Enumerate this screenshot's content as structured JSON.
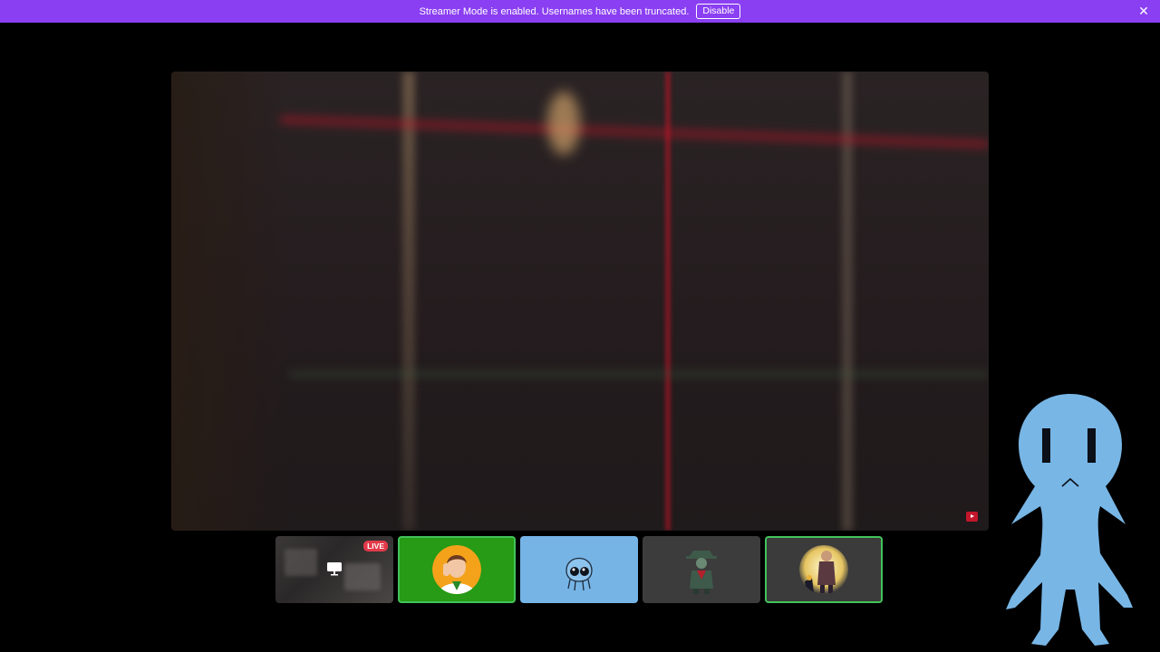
{
  "banner": {
    "message": "Streamer Mode is enabled. Usernames have been truncated.",
    "disable_label": "Disable",
    "close_glyph": "✕",
    "color": "#8a3ff2"
  },
  "stage": {
    "icon": "youtube-icon"
  },
  "tiles": [
    {
      "kind": "screen-share",
      "badge": "LIVE",
      "icon": "screen-share-icon"
    },
    {
      "kind": "avatar",
      "bg": "#279a16",
      "speaking": true
    },
    {
      "kind": "avatar",
      "bg": "#76b4e6",
      "speaking": false
    },
    {
      "kind": "avatar",
      "bg": "#3c3c3c",
      "speaking": false
    },
    {
      "kind": "avatar",
      "bg": "#3b3b3b",
      "speaking": true
    }
  ],
  "colors": {
    "accent": "#8a3ff2",
    "speaking_border": "#43c35a",
    "live_badge": "#e23a4a"
  }
}
